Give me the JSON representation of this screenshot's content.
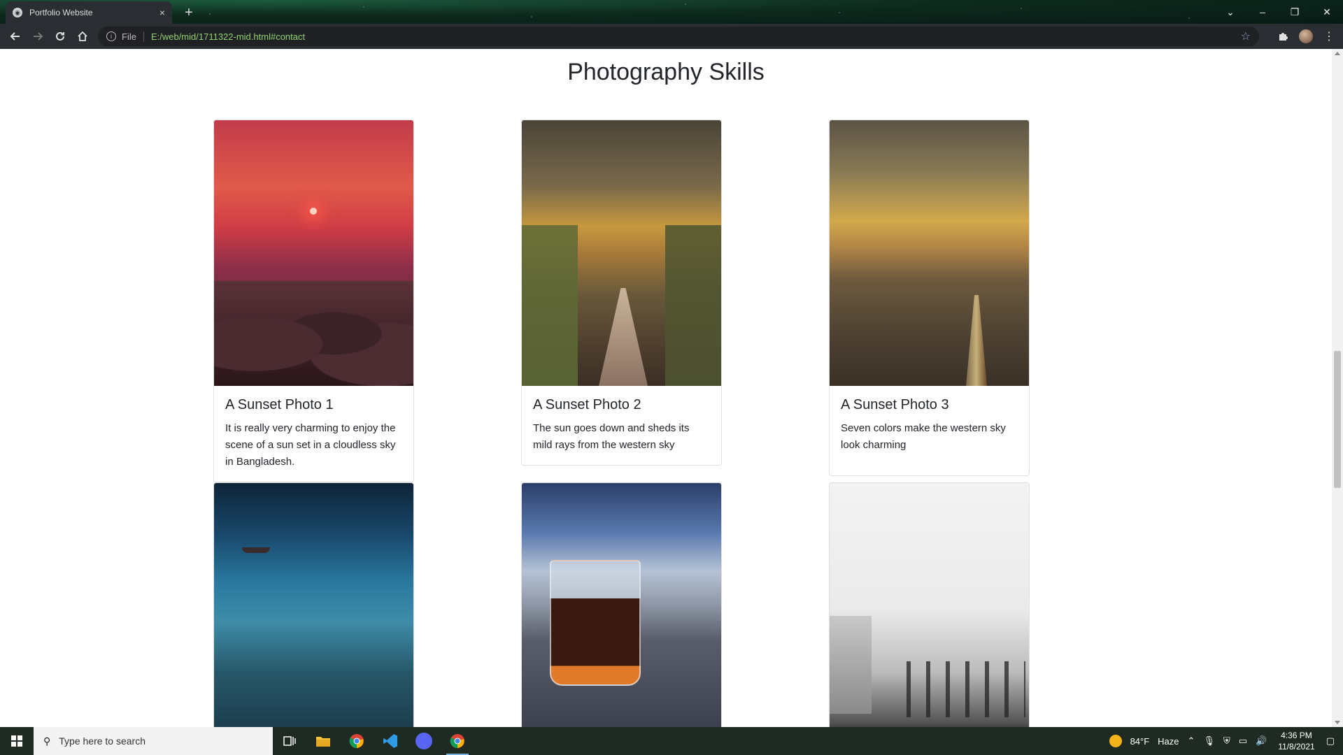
{
  "browser": {
    "tab_title": "Portfolio Website",
    "tab_close": "×",
    "new_tab": "+",
    "address_scheme_label": "File",
    "address_url": "E:/web/mid/1711322-mid.html#contact"
  },
  "page": {
    "section_title": "Photography Skills",
    "cards": [
      {
        "title": "A Sunset Photo 1",
        "text": "It is really very charming to enjoy the scene of a sun set in a cloudless sky in Bangladesh."
      },
      {
        "title": "A Sunset Photo 2",
        "text": "The sun goes down and sheds its mild rays from the western sky"
      },
      {
        "title": "A Sunset Photo 3",
        "text": "Seven colors make the western sky look charming"
      }
    ]
  },
  "taskbar": {
    "search_placeholder": "Type here to search",
    "weather_temp": "84°F",
    "weather_text": "Haze",
    "time": "4:36 PM",
    "date": "11/8/2021"
  },
  "colors": {
    "chrome_dark": "#2a2d31",
    "url_green": "#8fd16f",
    "taskbar": "#1f2a22"
  }
}
